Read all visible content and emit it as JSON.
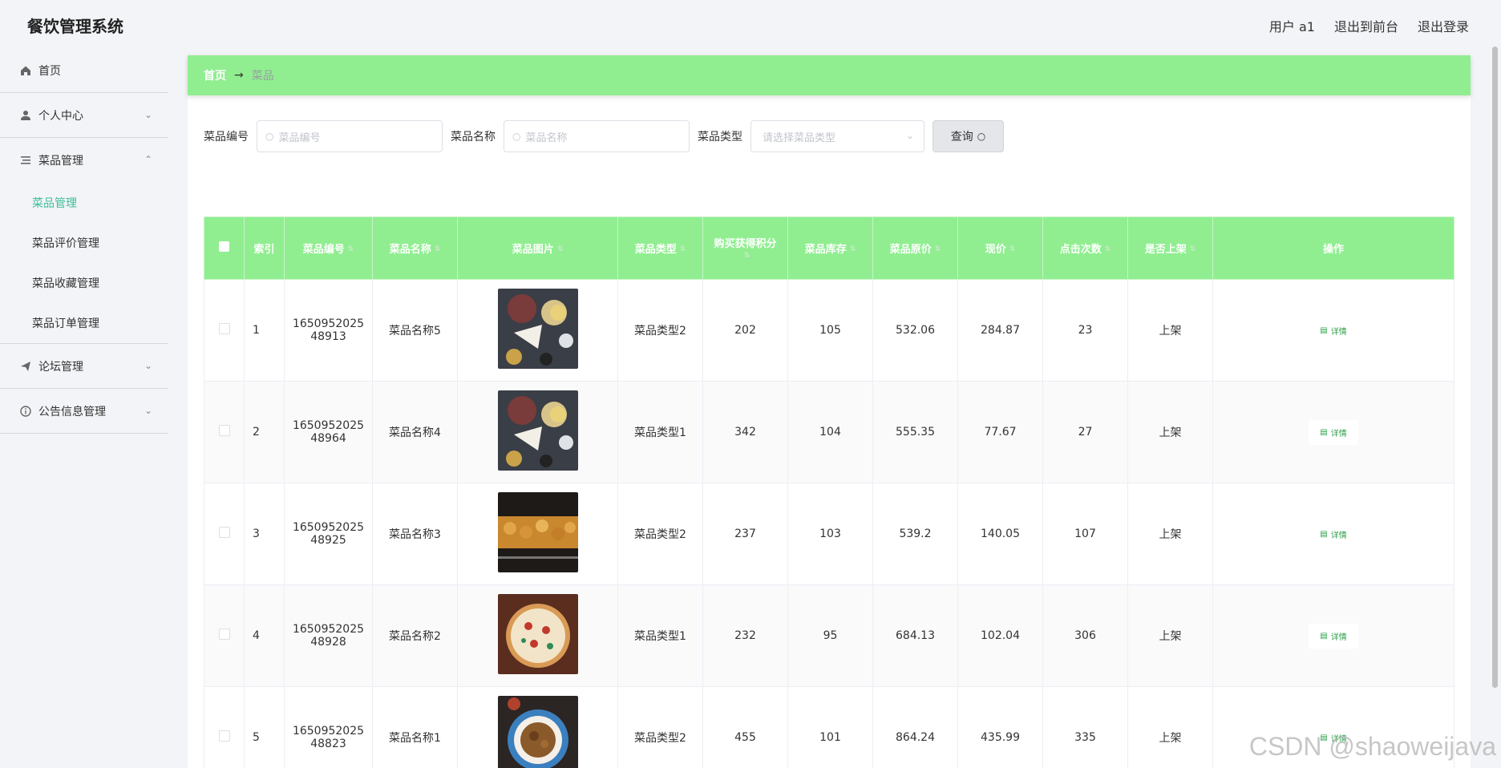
{
  "app": {
    "title": "餐饮管理系统"
  },
  "header": {
    "user": "用户 a1",
    "to_front": "退出到前台",
    "logout": "退出登录"
  },
  "sidebar": {
    "home": "首页",
    "personal": "个人中心",
    "dish_mgmt": "菜品管理",
    "subs": [
      "菜品管理",
      "菜品评价管理",
      "菜品收藏管理",
      "菜品订单管理"
    ],
    "forum": "论坛管理",
    "notice": "公告信息管理"
  },
  "breadcrumb": {
    "home": "首页",
    "arrow": "→",
    "current": "菜品"
  },
  "search": {
    "code_label": "菜品编号",
    "code_placeholder": "菜品编号",
    "name_label": "菜品名称",
    "name_placeholder": "菜品名称",
    "type_label": "菜品类型",
    "type_placeholder": "请选择菜品类型",
    "query": "查询"
  },
  "table": {
    "headers": [
      "索引",
      "菜品编号",
      "菜品名称",
      "菜品图片",
      "菜品类型",
      "购买获得积分",
      "菜品库存",
      "菜品原价",
      "现价",
      "点击次数",
      "是否上架",
      "操作"
    ],
    "detail_label": "详情",
    "rows": [
      {
        "idx": "1",
        "code_a": "1650952025",
        "code_b": "48913",
        "name": "菜品名称5",
        "type": "菜品类型2",
        "points": "202",
        "stock": "105",
        "orig": "532.06",
        "price": "284.87",
        "clicks": "23",
        "status": "上架",
        "img": "platter"
      },
      {
        "idx": "2",
        "code_a": "1650952025",
        "code_b": "48964",
        "name": "菜品名称4",
        "type": "菜品类型1",
        "points": "342",
        "stock": "104",
        "orig": "555.35",
        "price": "77.67",
        "clicks": "27",
        "status": "上架",
        "img": "platter"
      },
      {
        "idx": "3",
        "code_a": "1650952025",
        "code_b": "48925",
        "name": "菜品名称3",
        "type": "菜品类型2",
        "points": "237",
        "stock": "103",
        "orig": "539.2",
        "price": "140.05",
        "clicks": "107",
        "status": "上架",
        "img": "skewers"
      },
      {
        "idx": "4",
        "code_a": "1650952025",
        "code_b": "48928",
        "name": "菜品名称2",
        "type": "菜品类型1",
        "points": "232",
        "stock": "95",
        "orig": "684.13",
        "price": "102.04",
        "clicks": "306",
        "status": "上架",
        "img": "pizza"
      },
      {
        "idx": "5",
        "code_a": "1650952025",
        "code_b": "48823",
        "name": "菜品名称1",
        "type": "菜品类型2",
        "points": "455",
        "stock": "101",
        "orig": "864.24",
        "price": "435.99",
        "clicks": "335",
        "status": "上架",
        "img": "bowl"
      }
    ]
  },
  "watermark": "CSDN @shaoweijava",
  "colors": {
    "accent_green": "#90ee90",
    "active_teal": "#3dbd9b"
  }
}
